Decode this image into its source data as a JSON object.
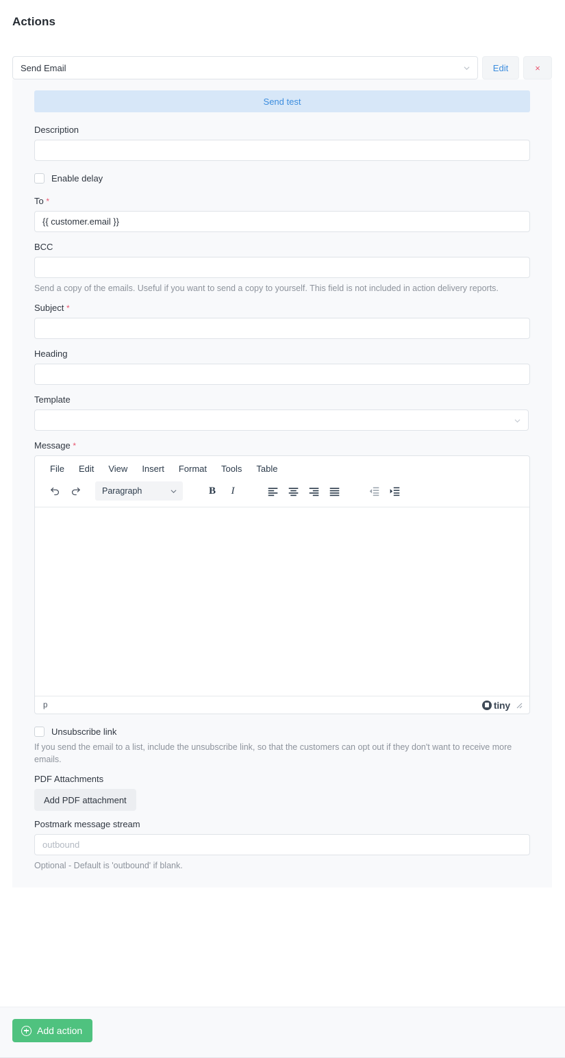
{
  "header": {
    "title": "Actions"
  },
  "action": {
    "type_value": "Send Email",
    "edit_label": "Edit",
    "remove_label": "×",
    "send_test_label": "Send test"
  },
  "fields": {
    "description": {
      "label": "Description",
      "value": ""
    },
    "enable_delay": {
      "label": "Enable delay",
      "checked": false
    },
    "to": {
      "label": "To",
      "required": "*",
      "value": "{{ customer.email }}"
    },
    "bcc": {
      "label": "BCC",
      "value": "",
      "help": "Send a copy of the emails. Useful if you want to send a copy to yourself. This field is not included in action delivery reports."
    },
    "subject": {
      "label": "Subject",
      "required": "*",
      "value": ""
    },
    "heading": {
      "label": "Heading",
      "value": ""
    },
    "template": {
      "label": "Template",
      "value": ""
    },
    "message": {
      "label": "Message",
      "required": "*"
    },
    "unsubscribe": {
      "label": "Unsubscribe link",
      "checked": false,
      "help": "If you send the email to a list, include the unsubscribe link, so that the customers can opt out if they don't want to receive more emails."
    },
    "pdf": {
      "label": "PDF Attachments",
      "button_label": "Add PDF attachment"
    },
    "postmark": {
      "label": "Postmark message stream",
      "value": "",
      "placeholder": "outbound",
      "help": "Optional - Default is 'outbound' if blank."
    }
  },
  "editor": {
    "menus": [
      "File",
      "Edit",
      "View",
      "Insert",
      "Format",
      "Tools",
      "Table"
    ],
    "format_value": "Paragraph",
    "bold_label": "B",
    "italic_label": "I",
    "status_path": "p",
    "brand": "tiny"
  },
  "footer": {
    "add_action_label": "Add action"
  },
  "colors": {
    "accent_blue": "#3c8dde",
    "send_test_bg": "#d7e7f8",
    "danger": "#e8566f",
    "success_green": "#4fc27f",
    "panel_bg": "#f8f9fb",
    "border": "#dfe3e8"
  }
}
